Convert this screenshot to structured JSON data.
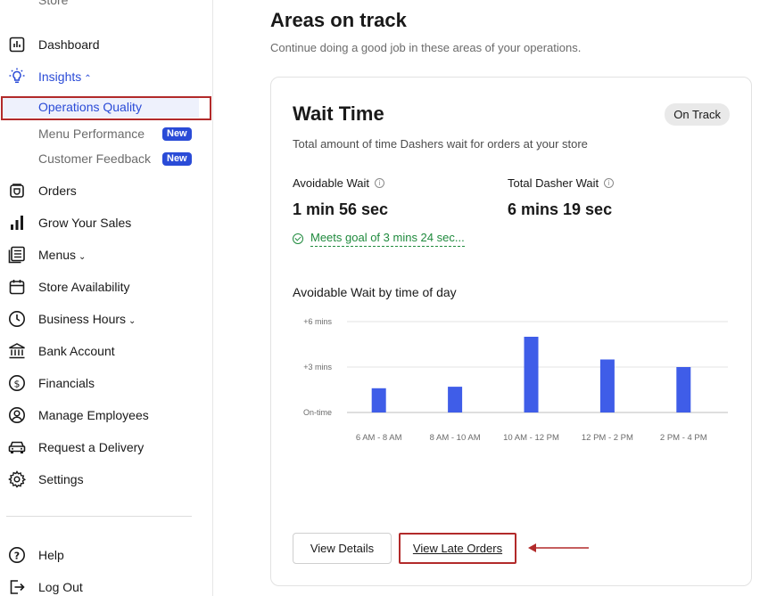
{
  "sidebar": {
    "store_cut_label": "Store",
    "items": [
      {
        "id": "dashboard",
        "label": "Dashboard",
        "icon": "dashboard-icon"
      },
      {
        "id": "insights",
        "label": "Insights",
        "icon": "lightbulb-icon",
        "chevron": "⌃"
      },
      {
        "id": "orders",
        "label": "Orders",
        "icon": "orders-bag-icon"
      },
      {
        "id": "grow",
        "label": "Grow Your Sales",
        "icon": "bar-chart-icon"
      },
      {
        "id": "menus",
        "label": "Menus",
        "icon": "menu-book-icon",
        "chevron": "⌄"
      },
      {
        "id": "availability",
        "label": "Store Availability",
        "icon": "calendar-icon"
      },
      {
        "id": "hours",
        "label": "Business Hours",
        "icon": "clock-icon",
        "chevron": "⌄"
      },
      {
        "id": "bank",
        "label": "Bank Account",
        "icon": "bank-icon"
      },
      {
        "id": "financials",
        "label": "Financials",
        "icon": "dollar-circle-icon"
      },
      {
        "id": "employees",
        "label": "Manage Employees",
        "icon": "user-circle-icon"
      },
      {
        "id": "delivery",
        "label": "Request a Delivery",
        "icon": "car-icon"
      },
      {
        "id": "settings",
        "label": "Settings",
        "icon": "gear-icon"
      },
      {
        "id": "help",
        "label": "Help",
        "icon": "help-icon"
      },
      {
        "id": "logout",
        "label": "Log Out",
        "icon": "logout-icon"
      }
    ],
    "sub_items": [
      {
        "label": "Operations Quality",
        "badge": ""
      },
      {
        "label": "Menu Performance",
        "badge": "New"
      },
      {
        "label": "Customer Feedback",
        "badge": "New"
      }
    ]
  },
  "main": {
    "title": "Areas on track",
    "subtitle": "Continue doing a good job in these areas of your operations."
  },
  "card": {
    "title": "Wait Time",
    "status": "On Track",
    "description": "Total amount of time Dashers wait for orders at your store",
    "metrics": [
      {
        "label": "Avoidable Wait",
        "value": "1 min 56 sec"
      },
      {
        "label": "Total Dasher Wait",
        "value": "6 mins 19 sec"
      }
    ],
    "goal_text": "Meets goal of 3 mins 24 sec...",
    "chart_title": "Avoidable Wait by time of day",
    "buttons": {
      "details": "View Details",
      "late_orders": "View Late Orders"
    }
  },
  "colors": {
    "accent": "#2a4bd7",
    "bar": "#3f5de8",
    "success": "#1f8a3d",
    "highlight_outline": "#b22a2a"
  },
  "chart_data": {
    "type": "bar",
    "title": "Avoidable Wait by time of day",
    "categories": [
      "6 AM - 8 AM",
      "8 AM - 10 AM",
      "10 AM - 12 PM",
      "12 PM - 2 PM",
      "2 PM - 4 PM"
    ],
    "values": [
      1.6,
      1.7,
      5.0,
      3.5,
      3.0
    ],
    "y_unit": "mins",
    "y_ticks": [
      {
        "value": 0,
        "label": "On-time"
      },
      {
        "value": 3,
        "label": "+3 mins"
      },
      {
        "value": 6,
        "label": "+6 mins"
      }
    ],
    "ylim": [
      0,
      6
    ],
    "grid": true
  }
}
